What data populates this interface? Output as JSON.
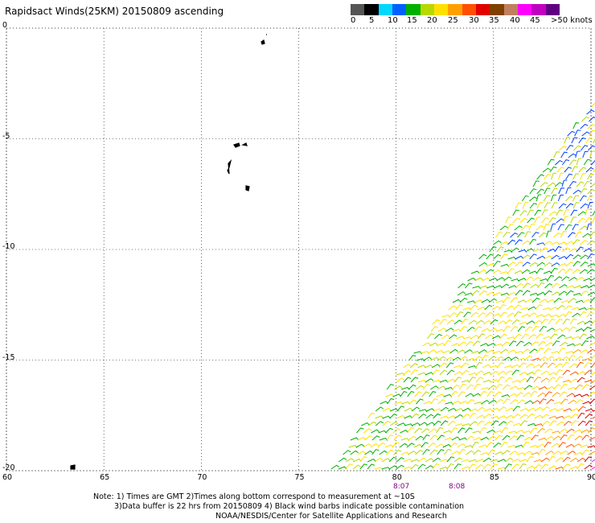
{
  "title": "Rapidsact Winds(25KM) 20150809 ascending",
  "scale": {
    "colors": [
      "#555555",
      "#000000",
      "#00d8ff",
      "#0060ff",
      "#00b000",
      "#b8d800",
      "#ffe000",
      "#ffa000",
      "#ff5000",
      "#e00000",
      "#804000",
      "#c08060",
      "#ff00ff",
      "#c000c0",
      "#600080"
    ],
    "labels": [
      "0",
      "5",
      "10",
      "15",
      "20",
      "25",
      "30",
      "35",
      "40",
      "45",
      ">50 knots"
    ]
  },
  "axes": {
    "lon_ticks": [
      "60",
      "65",
      "70",
      "75",
      "80",
      "85",
      "90"
    ],
    "lat_ticks": [
      "0",
      "-5",
      "-10",
      "-15",
      "-20"
    ]
  },
  "swath_times": [
    "8:07",
    "8:08"
  ],
  "notes": [
    "Note: 1) Times are GMT 2)Times along bottom correspond to measurement at ~10S",
    "3)Data buffer is 22 hrs from 20150809 4) Black wind barbs indicate possible contamination",
    "NOAA/NESDIS/Center for Satellite Applications and Research"
  ]
}
